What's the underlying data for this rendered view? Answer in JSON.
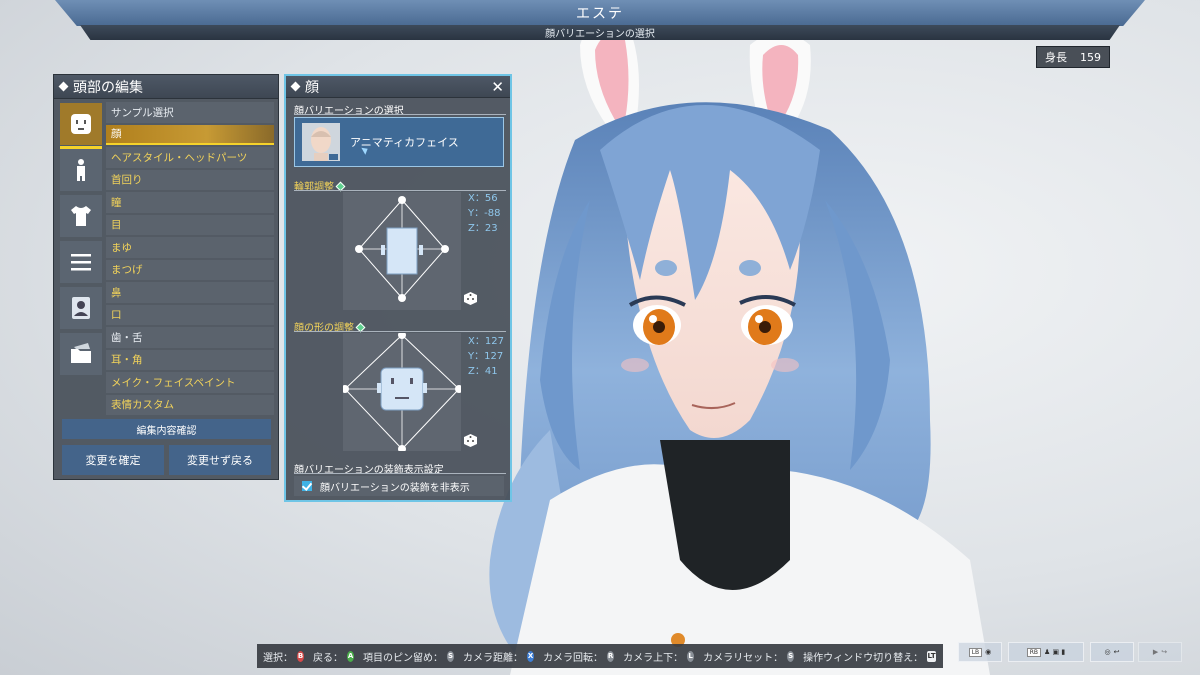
{
  "header": {
    "title": "エステ",
    "subtitle": "顔バリエーションの選択"
  },
  "height": {
    "label": "身長",
    "value": "159"
  },
  "left_panel": {
    "title": "頭部の編集",
    "icons": [
      "face-icon",
      "body-icon",
      "clothing-icon",
      "menu-icon",
      "id-card-icon",
      "folder-icon"
    ],
    "items": [
      {
        "label": "サンプル選択"
      },
      {
        "label": "顔"
      },
      {
        "label": "ヘアスタイル・ヘッドパーツ"
      },
      {
        "label": "首回り"
      },
      {
        "label": "瞳"
      },
      {
        "label": "目"
      },
      {
        "label": "まゆ"
      },
      {
        "label": "まつげ"
      },
      {
        "label": "鼻"
      },
      {
        "label": "口"
      },
      {
        "label": "歯・舌"
      },
      {
        "label": "耳・角"
      },
      {
        "label": "メイク・フェイスペイント"
      },
      {
        "label": "表情カスタム"
      }
    ],
    "confirm_label": "編集内容確認",
    "apply_label": "変更を確定",
    "cancel_label": "変更せず戻る"
  },
  "face_panel": {
    "title": "顔",
    "close_glyph": "✕",
    "variation_section": "顔バリエーションの選択",
    "variation_name": "アニマティカフェイス",
    "contour_section": "輪郭調整",
    "contour": {
      "x_label": "X：",
      "x": "56",
      "y_label": "Y：",
      "y": "-88",
      "z_label": "Z：",
      "z": "23"
    },
    "shape_section": "顔の形の調整",
    "shape": {
      "x_label": "X：",
      "x": "127",
      "y_label": "Y：",
      "y": "127",
      "z_label": "Z：",
      "z": "41"
    },
    "deco_section": "顔バリエーションの装飾表示設定",
    "deco_checkbox_label": "顔バリエーションの装飾を非表示",
    "deco_checked": true
  },
  "help_bar": {
    "items": [
      {
        "label": "選択：",
        "glyph": "B"
      },
      {
        "label": "戻る：",
        "glyph": "A"
      },
      {
        "label": "項目のピン留め：",
        "glyph": "S"
      },
      {
        "label": "カメラ距離：",
        "glyph": "X"
      },
      {
        "label": "カメラ回転：",
        "glyph": "R"
      },
      {
        "label": "カメラ上下：",
        "glyph": "L"
      },
      {
        "label": "カメラリセット：",
        "glyph": "S"
      },
      {
        "label": "操作ウィンドウ切り替え：",
        "glyph": "LT"
      }
    ]
  },
  "mini_boxes": [
    {
      "chip": "LB"
    },
    {
      "chip": "RB"
    },
    {
      "chip": ""
    },
    {
      "chip": ""
    }
  ],
  "colors": {
    "accent_gold": "#f5d22a",
    "panel_border_active": "#6fc5e6",
    "button_blue": "#44648a",
    "coord_text": "#8fc7ec"
  }
}
